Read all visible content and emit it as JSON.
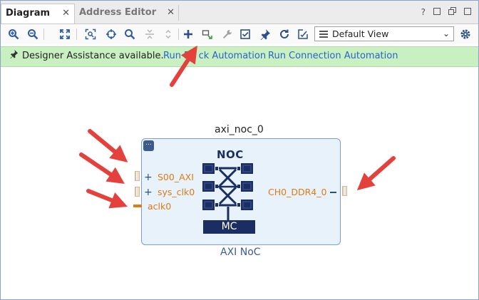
{
  "tabs": [
    {
      "label": "Diagram",
      "active": true
    },
    {
      "label": "Address Editor",
      "active": false
    }
  ],
  "window_controls": {
    "help": "?"
  },
  "toolbar": {
    "view_select": {
      "value": "Default View",
      "options": [
        "Default View"
      ]
    },
    "icons": [
      "zoom-in-icon",
      "zoom-out-icon",
      "fit-icon",
      "zoom-fit-selection-icon",
      "select-area-icon",
      "search-icon",
      "collapse-icon",
      "expand-icon",
      "add-ip-icon",
      "add-module-icon",
      "wrench-icon",
      "validate-icon",
      "pin-icon",
      "refresh-icon",
      "regenerate-layout-icon",
      "gear-icon"
    ]
  },
  "banner": {
    "message": "Designer Assistance available.",
    "link1": "Run Block Automation",
    "link1_visible": "Run B",
    "link1_rest": "ck Automation",
    "link2": "Run Connection Automation"
  },
  "block": {
    "instance_name": "axi_noc_0",
    "type_name": "AXI NoC",
    "ports_left": [
      "S00_AXI",
      "sys_clk0",
      "aclk0"
    ],
    "ports_right": [
      "CH0_DDR4_0"
    ],
    "symbol_title": "NOC",
    "symbol_label": "MC"
  },
  "colors": {
    "accent_port": "#e07a14",
    "block_fill": "#e7f2fb",
    "block_border": "#7c9fd0",
    "banner_bg": "#c9f0c0",
    "link": "#2a62c9",
    "arrow": "#e5413c",
    "noc_dark": "#1b2e63"
  }
}
